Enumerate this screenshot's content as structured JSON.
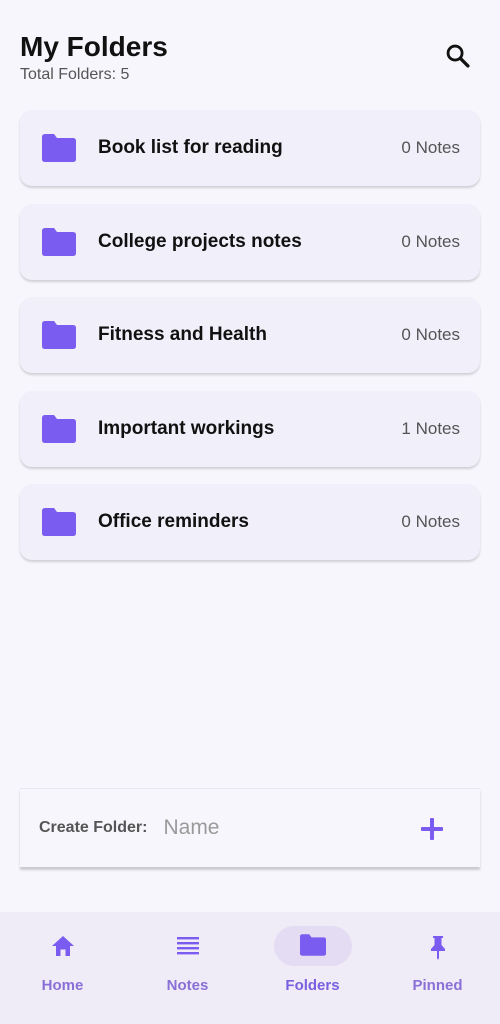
{
  "header": {
    "title": "My Folders",
    "subtitle": "Total Folders: 5",
    "search_icon": "search-icon"
  },
  "folders": [
    {
      "name": "Book list for reading",
      "count": "0 Notes"
    },
    {
      "name": "College projects notes",
      "count": "0 Notes"
    },
    {
      "name": "Fitness and Health",
      "count": "0 Notes"
    },
    {
      "name": "Important workings",
      "count": "1 Notes"
    },
    {
      "name": "Office reminders",
      "count": "0 Notes"
    }
  ],
  "create_folder": {
    "label": "Create Folder:",
    "placeholder": "Name",
    "value": "",
    "add_icon": "plus-icon"
  },
  "nav": {
    "items": [
      {
        "label": "Home",
        "icon": "home-icon"
      },
      {
        "label": "Notes",
        "icon": "notes-icon"
      },
      {
        "label": "Folders",
        "icon": "folder-icon",
        "active": true
      },
      {
        "label": "Pinned",
        "icon": "pin-icon"
      }
    ]
  },
  "colors": {
    "accent": "#7b5cf0",
    "background": "#f7f6fc",
    "card": "#f1eff9",
    "nav_background": "#efecf8",
    "nav_active_pill": "#e3dcf3"
  }
}
